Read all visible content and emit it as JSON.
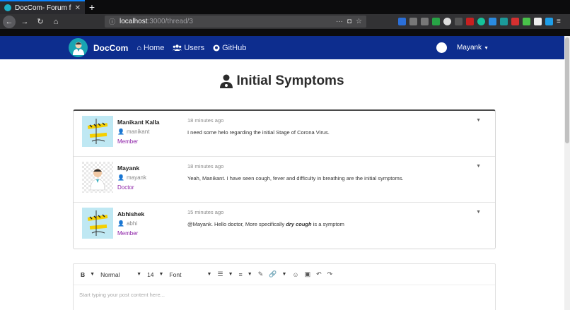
{
  "browser": {
    "tab_title": "DocCom- Forum for Do",
    "url_host": "localhost",
    "url_path": ":3000/thread/3"
  },
  "nav": {
    "brand": "DocCom",
    "home": "Home",
    "users": "Users",
    "github": "GitHub",
    "user": "Mayank"
  },
  "thread": {
    "title": "Initial Symptoms"
  },
  "posts": [
    {
      "name": "Manikant Kalla",
      "username": "manikant",
      "role": "Member",
      "time": "18 minutes ago",
      "text": "I need some helo regarding the initial Stage of Corona Virus."
    },
    {
      "name": "Mayank",
      "username": "mayank",
      "role": "Doctor",
      "time": "18 minutes ago",
      "text": "Yeah, Manikant. I have seen cough, fever and difficulty in breathing are the initial symptoms."
    },
    {
      "name": "Abhishek",
      "username": "abhi",
      "role": "Member",
      "time": "15 minutes ago",
      "text_before": "@Mayank. Hello doctor, More specifically ",
      "text_em": "dry cough",
      "text_after": " is a symptom"
    }
  ],
  "editor": {
    "format": "Normal",
    "size": "14",
    "font": "Font",
    "bold": "B",
    "placeholder": "Start typing your post content here..."
  },
  "colors": {
    "navbar": "#0d2d8e",
    "role": "#8b1ea6"
  }
}
